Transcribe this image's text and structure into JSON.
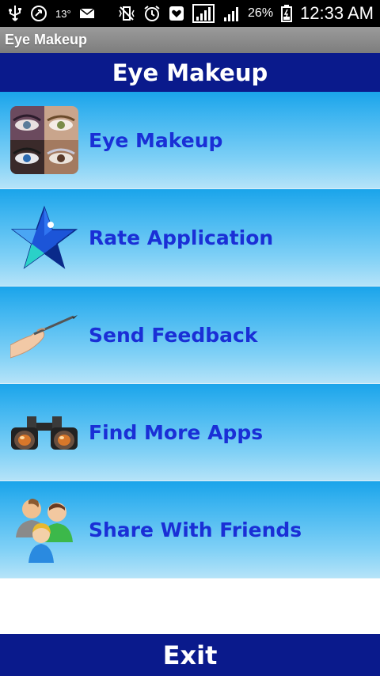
{
  "status_bar": {
    "temperature": "13°",
    "battery_percent": "26%",
    "time": "12:33 AM",
    "icons": [
      "usb-icon",
      "sync-icon",
      "temperature",
      "mail-icon",
      "mute-vibrate-icon",
      "alarm-icon",
      "heart-icon",
      "signal-icon",
      "signal-icon",
      "battery-icon"
    ]
  },
  "action_bar": {
    "title": "Eye Makeup"
  },
  "header": {
    "title": "Eye Makeup"
  },
  "menu": {
    "items": [
      {
        "label": "Eye Makeup",
        "icon": "eye-makeup-thumbnail-icon"
      },
      {
        "label": "Rate Application",
        "icon": "star-icon"
      },
      {
        "label": "Send Feedback",
        "icon": "hand-pen-icon"
      },
      {
        "label": "Find More Apps",
        "icon": "binoculars-icon"
      },
      {
        "label": "Share With Friends",
        "icon": "people-icon"
      }
    ]
  },
  "footer": {
    "exit_label": "Exit"
  },
  "colors": {
    "header_bg": "#0a1a8c",
    "menu_label": "#1a2fd6",
    "menu_gradient_top": "#1aa4ea",
    "menu_gradient_bottom": "#b5e3f8"
  }
}
